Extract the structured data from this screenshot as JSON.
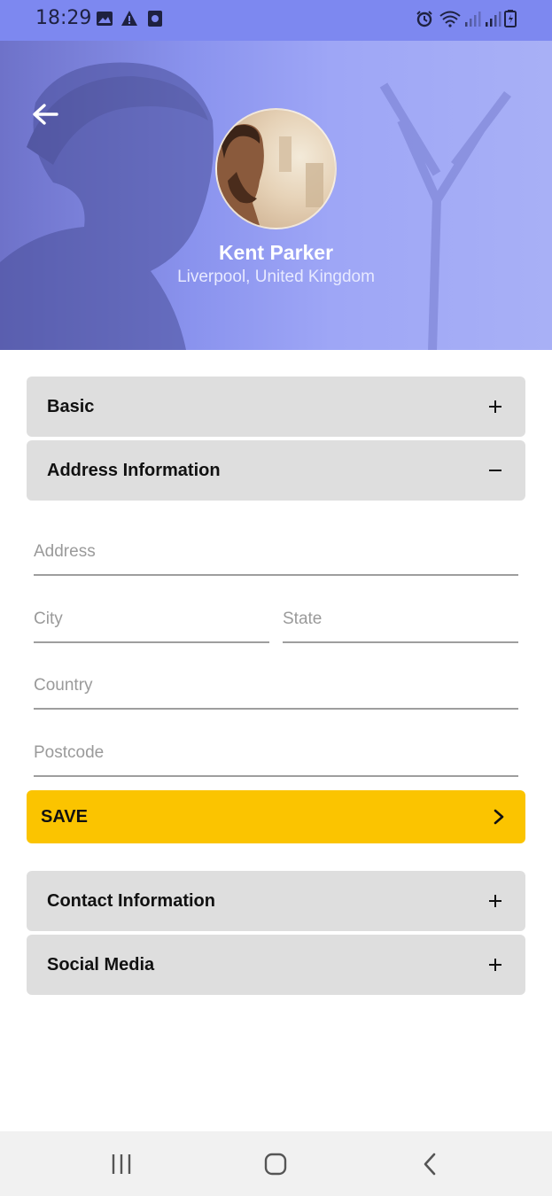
{
  "status_bar": {
    "time": "18:29",
    "icons": [
      "image-icon",
      "warning-icon",
      "app-icon",
      "alarm-icon",
      "wifi-icon",
      "signal-icon",
      "signal-icon",
      "battery-icon"
    ]
  },
  "profile": {
    "name": "Kent Parker",
    "location": "Liverpool, United Kingdom"
  },
  "sections": {
    "basic": {
      "label": "Basic",
      "expanded": false
    },
    "address": {
      "label": "Address Information",
      "expanded": true
    },
    "contact": {
      "label": "Contact Information",
      "expanded": false
    },
    "social": {
      "label": "Social Media",
      "expanded": false
    }
  },
  "address_form": {
    "address_placeholder": "Address",
    "city_placeholder": "City",
    "state_placeholder": "State",
    "country_placeholder": "Country",
    "postcode_placeholder": "Postcode",
    "save_label": "SAVE"
  },
  "colors": {
    "header": "#7d88f0",
    "save_button": "#fbc400",
    "panel": "#dedede"
  }
}
